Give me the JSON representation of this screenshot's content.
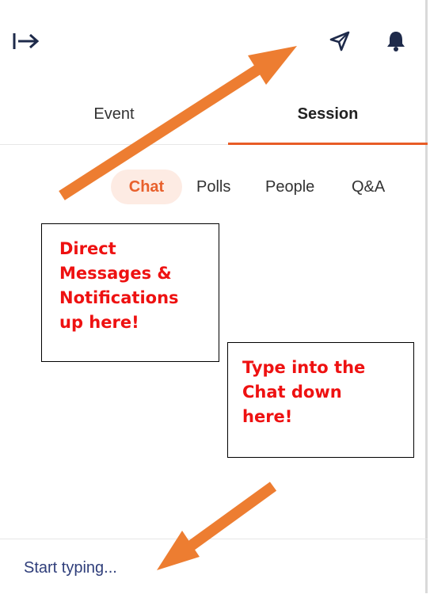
{
  "colors": {
    "accent": "#e85c27",
    "chat_pill_bg": "#fdebe3",
    "annotation_text": "#ee1111",
    "arrow": "#ed7d31",
    "input_text": "#2f3e7a"
  },
  "header": {
    "icons": [
      "collapse-panel-icon",
      "send-icon",
      "bell-icon"
    ]
  },
  "tabs": [
    {
      "label": "Event",
      "active": false
    },
    {
      "label": "Session",
      "active": true
    }
  ],
  "subtabs": [
    {
      "label": "Chat",
      "active": true
    },
    {
      "label": "Polls",
      "active": false
    },
    {
      "label": "People",
      "active": false
    },
    {
      "label": "Q&A",
      "active": false
    }
  ],
  "annotations": {
    "top_note": "Direct\nMessages &\nNotifications\nup here!",
    "bottom_note": "Type into the\nChat down\nhere!"
  },
  "composer": {
    "placeholder": "Start typing..."
  }
}
